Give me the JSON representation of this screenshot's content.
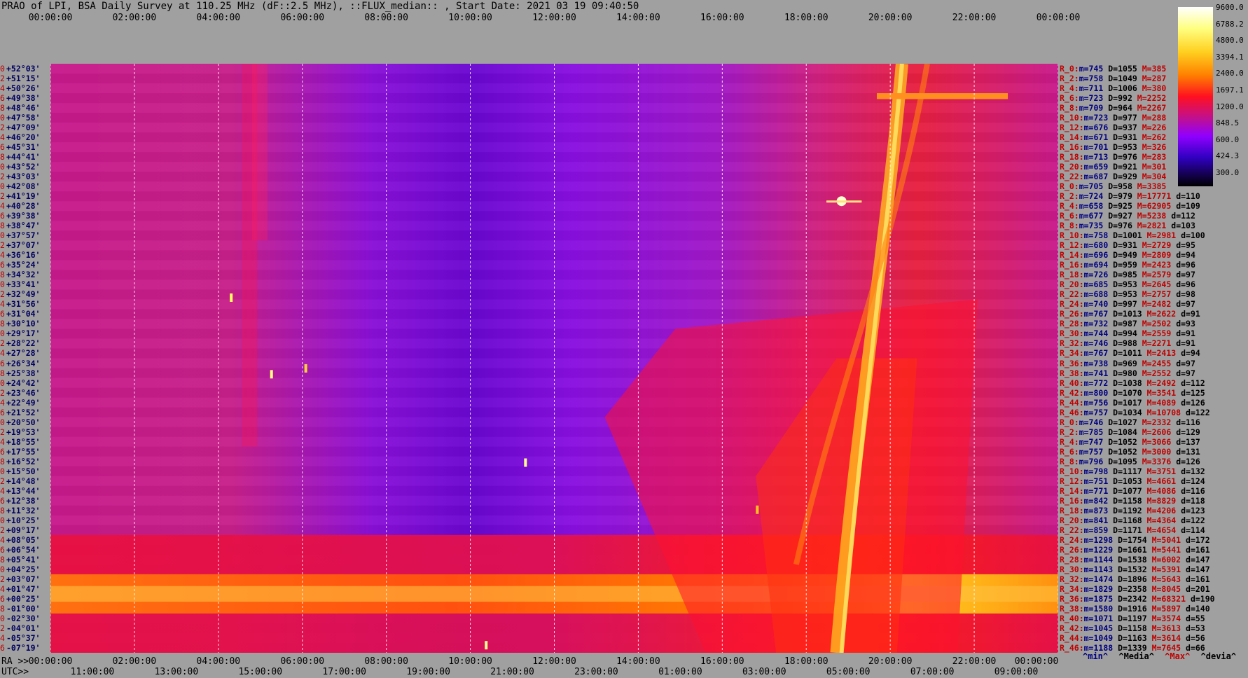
{
  "title": "PRAO of LPI, BSA Daily Survey at 110.25 MHz (dF::2.5 MHz), ::FLUX_median:: , Start Date: 2021 03 19 09:40:50",
  "chart_data": {
    "type": "heatmap",
    "title": "PRAO of LPI, BSA Daily Survey at 110.25 MHz (dF::2.5 MHz), ::FLUX_median:: , Start Date: 2021 03 19 09:40:50",
    "top_ticks": [
      "00:00:00",
      "02:00:00",
      "04:00:00",
      "06:00:00",
      "08:00:00",
      "10:00:00",
      "12:00:00",
      "14:00:00",
      "16:00:00",
      "18:00:00",
      "20:00:00",
      "22:00:00",
      "00:00:00"
    ],
    "ra_prefix": "RA >>",
    "ra_ticks": [
      "00:00:00",
      "02:00:00",
      "04:00:00",
      "06:00:00",
      "08:00:00",
      "10:00:00",
      "12:00:00",
      "14:00:00",
      "16:00:00",
      "18:00:00",
      "20:00:00",
      "22:00:00",
      "00:00:00"
    ],
    "utc_prefix": "UTC>>",
    "utc_ticks": [
      "11:00:00",
      "13:00:00",
      "15:00:00",
      "17:00:00",
      "19:00:00",
      "21:00:00",
      "23:00:00",
      "01:00:00",
      "03:00:00",
      "05:00:00",
      "07:00:00",
      "09:00:00"
    ],
    "colorbar": {
      "labels": [
        "9600.0",
        "6788.2",
        "4800.0",
        "3394.1",
        "2400.0",
        "1697.1",
        "1200.0",
        "848.5",
        "600.0",
        "424.3",
        "300.0"
      ],
      "range": [
        300,
        9600
      ],
      "scale": "log",
      "colors": [
        "#000010",
        "#2a0090",
        "#8000ff",
        "#c020c0",
        "#ff0030",
        "#ff5000",
        "#ffa000",
        "#ffe040",
        "#ffffc0"
      ]
    },
    "declination_rows": [
      {
        "i": "0",
        "dec": "+52°03'"
      },
      {
        "i": "2",
        "dec": "+51°15'"
      },
      {
        "i": "4",
        "dec": "+50°26'"
      },
      {
        "i": "6",
        "dec": "+49°38'"
      },
      {
        "i": "8",
        "dec": "+48°46'"
      },
      {
        "i": "10",
        "dec": "+47°58'"
      },
      {
        "i": "12",
        "dec": "+47°09'"
      },
      {
        "i": "14",
        "dec": "+46°20'"
      },
      {
        "i": "16",
        "dec": "+45°31'"
      },
      {
        "i": "18",
        "dec": "+44°41'"
      },
      {
        "i": "20",
        "dec": "+43°52'"
      },
      {
        "i": "22",
        "dec": "+43°03'"
      },
      {
        "i": "0",
        "dec": "+42°08'"
      },
      {
        "i": "2",
        "dec": "+41°19'"
      },
      {
        "i": "4",
        "dec": "+40°28'"
      },
      {
        "i": "6",
        "dec": "+39°38'"
      },
      {
        "i": "8",
        "dec": "+38°47'"
      },
      {
        "i": "10",
        "dec": "+37°57'"
      },
      {
        "i": "12",
        "dec": "+37°07'"
      },
      {
        "i": "14",
        "dec": "+36°16'"
      },
      {
        "i": "16",
        "dec": "+35°24'"
      },
      {
        "i": "18",
        "dec": "+34°32'"
      },
      {
        "i": "20",
        "dec": "+33°41'"
      },
      {
        "i": "22",
        "dec": "+32°49'"
      },
      {
        "i": "24",
        "dec": "+31°56'"
      },
      {
        "i": "26",
        "dec": "+31°04'"
      },
      {
        "i": "28",
        "dec": "+30°10'"
      },
      {
        "i": "30",
        "dec": "+29°17'"
      },
      {
        "i": "32",
        "dec": "+28°22'"
      },
      {
        "i": "34",
        "dec": "+27°28'"
      },
      {
        "i": "36",
        "dec": "+26°34'"
      },
      {
        "i": "38",
        "dec": "+25°38'"
      },
      {
        "i": "40",
        "dec": "+24°42'"
      },
      {
        "i": "42",
        "dec": "+23°46'"
      },
      {
        "i": "44",
        "dec": "+22°49'"
      },
      {
        "i": "46",
        "dec": "+21°52'"
      },
      {
        "i": "0",
        "dec": "+20°50'"
      },
      {
        "i": "2",
        "dec": "+19°53'"
      },
      {
        "i": "4",
        "dec": "+18°55'"
      },
      {
        "i": "6",
        "dec": "+17°55'"
      },
      {
        "i": "8",
        "dec": "+16°52'"
      },
      {
        "i": "10",
        "dec": "+15°50'"
      },
      {
        "i": "12",
        "dec": "+14°48'"
      },
      {
        "i": "14",
        "dec": "+13°44'"
      },
      {
        "i": "16",
        "dec": "+12°38'"
      },
      {
        "i": "18",
        "dec": "+11°32'"
      },
      {
        "i": "20",
        "dec": "+10°25'"
      },
      {
        "i": "22",
        "dec": "+09°17'"
      },
      {
        "i": "24",
        "dec": "+08°05'"
      },
      {
        "i": "26",
        "dec": "+06°54'"
      },
      {
        "i": "28",
        "dec": "+05°41'"
      },
      {
        "i": "30",
        "dec": "+04°25'"
      },
      {
        "i": "32",
        "dec": "+03°07'"
      },
      {
        "i": "34",
        "dec": "+01°47'"
      },
      {
        "i": "36",
        "dec": "+00°25'"
      },
      {
        "i": "38",
        "dec": "-01°00'"
      },
      {
        "i": "40",
        "dec": "-02°30'"
      },
      {
        "i": "42",
        "dec": "-04°01'"
      },
      {
        "i": "44",
        "dec": "-05°37'"
      },
      {
        "i": "46",
        "dec": "-07°19'"
      }
    ],
    "stats_rows": [
      {
        "r": "R_0:",
        "m": "745",
        "d": "1055",
        "h": "385",
        "dv": ""
      },
      {
        "r": "R_2:",
        "m": "758",
        "d": "1049",
        "h": "287",
        "dv": ""
      },
      {
        "r": "R_4:",
        "m": "711",
        "d": "1006",
        "h": "380",
        "dv": ""
      },
      {
        "r": "R_6:",
        "m": "723",
        "d": "992",
        "h": "2252",
        "dv": ""
      },
      {
        "r": "R_8:",
        "m": "709",
        "d": "964",
        "h": "2267",
        "dv": ""
      },
      {
        "r": "R_10:",
        "m": "723",
        "d": "977",
        "h": "288",
        "dv": ""
      },
      {
        "r": "R_12:",
        "m": "676",
        "d": "937",
        "h": "226",
        "dv": ""
      },
      {
        "r": "R_14:",
        "m": "671",
        "d": "931",
        "h": "262",
        "dv": ""
      },
      {
        "r": "R_16:",
        "m": "701",
        "d": "953",
        "h": "326",
        "dv": ""
      },
      {
        "r": "R_18:",
        "m": "713",
        "d": "976",
        "h": "283",
        "dv": ""
      },
      {
        "r": "R_20:",
        "m": "659",
        "d": "921",
        "h": "301",
        "dv": ""
      },
      {
        "r": "R_22:",
        "m": "687",
        "d": "929",
        "h": "304",
        "dv": ""
      },
      {
        "r": "R_0:",
        "m": "705",
        "d": "958",
        "h": "3385",
        "dv": ""
      },
      {
        "r": "R_2:",
        "m": "724",
        "d": "979",
        "h": "17771",
        "dv": "110"
      },
      {
        "r": "R_4:",
        "m": "658",
        "d": "925",
        "h": "62905",
        "dv": "109"
      },
      {
        "r": "R_6:",
        "m": "677",
        "d": "927",
        "h": "5238",
        "dv": "112"
      },
      {
        "r": "R_8:",
        "m": "735",
        "d": "976",
        "h": "2821",
        "dv": "103"
      },
      {
        "r": "R_10:",
        "m": "758",
        "d": "1001",
        "h": "2981",
        "dv": "100"
      },
      {
        "r": "R_12:",
        "m": "680",
        "d": "931",
        "h": "2729",
        "dv": "95"
      },
      {
        "r": "R_14:",
        "m": "696",
        "d": "949",
        "h": "2809",
        "dv": "94"
      },
      {
        "r": "R_16:",
        "m": "694",
        "d": "959",
        "h": "2423",
        "dv": "96"
      },
      {
        "r": "R_18:",
        "m": "726",
        "d": "985",
        "h": "2579",
        "dv": "97"
      },
      {
        "r": "R_20:",
        "m": "685",
        "d": "953",
        "h": "2645",
        "dv": "96"
      },
      {
        "r": "R_22:",
        "m": "688",
        "d": "953",
        "h": "2757",
        "dv": "98"
      },
      {
        "r": "R_24:",
        "m": "740",
        "d": "997",
        "h": "2482",
        "dv": "97"
      },
      {
        "r": "R_26:",
        "m": "767",
        "d": "1013",
        "h": "2622",
        "dv": "91"
      },
      {
        "r": "R_28:",
        "m": "732",
        "d": "987",
        "h": "2502",
        "dv": "93"
      },
      {
        "r": "R_30:",
        "m": "744",
        "d": "994",
        "h": "2559",
        "dv": "91"
      },
      {
        "r": "R_32:",
        "m": "746",
        "d": "988",
        "h": "2271",
        "dv": "91"
      },
      {
        "r": "R_34:",
        "m": "767",
        "d": "1011",
        "h": "2413",
        "dv": "94"
      },
      {
        "r": "R_36:",
        "m": "738",
        "d": "969",
        "h": "2455",
        "dv": "97"
      },
      {
        "r": "R_38:",
        "m": "741",
        "d": "980",
        "h": "2552",
        "dv": "97"
      },
      {
        "r": "R_40:",
        "m": "772",
        "d": "1038",
        "h": "2492",
        "dv": "112"
      },
      {
        "r": "R_42:",
        "m": "800",
        "d": "1070",
        "h": "3541",
        "dv": "125"
      },
      {
        "r": "R_44:",
        "m": "756",
        "d": "1017",
        "h": "4089",
        "dv": "126"
      },
      {
        "r": "R_46:",
        "m": "757",
        "d": "1034",
        "h": "10708",
        "dv": "122"
      },
      {
        "r": "R_0:",
        "m": "746",
        "d": "1027",
        "h": "2332",
        "dv": "116"
      },
      {
        "r": "R_2:",
        "m": "785",
        "d": "1084",
        "h": "2606",
        "dv": "129"
      },
      {
        "r": "R_4:",
        "m": "747",
        "d": "1052",
        "h": "3066",
        "dv": "137"
      },
      {
        "r": "R_6:",
        "m": "757",
        "d": "1052",
        "h": "3000",
        "dv": "131"
      },
      {
        "r": "R_8:",
        "m": "796",
        "d": "1095",
        "h": "3376",
        "dv": "126"
      },
      {
        "r": "R_10:",
        "m": "798",
        "d": "1117",
        "h": "3751",
        "dv": "132"
      },
      {
        "r": "R_12:",
        "m": "751",
        "d": "1053",
        "h": "4661",
        "dv": "124"
      },
      {
        "r": "R_14:",
        "m": "771",
        "d": "1077",
        "h": "4086",
        "dv": "116"
      },
      {
        "r": "R_16:",
        "m": "842",
        "d": "1158",
        "h": "8829",
        "dv": "118"
      },
      {
        "r": "R_18:",
        "m": "873",
        "d": "1192",
        "h": "4206",
        "dv": "123"
      },
      {
        "r": "R_20:",
        "m": "841",
        "d": "1168",
        "h": "4364",
        "dv": "122"
      },
      {
        "r": "R_22:",
        "m": "859",
        "d": "1171",
        "h": "4654",
        "dv": "114"
      },
      {
        "r": "R_24:",
        "m": "1298",
        "d": "1754",
        "h": "5041",
        "dv": "172"
      },
      {
        "r": "R_26:",
        "m": "1229",
        "d": "1661",
        "h": "5441",
        "dv": "161"
      },
      {
        "r": "R_28:",
        "m": "1144",
        "d": "1538",
        "h": "6002",
        "dv": "147"
      },
      {
        "r": "R_30:",
        "m": "1143",
        "d": "1532",
        "h": "5391",
        "dv": "147"
      },
      {
        "r": "R_32:",
        "m": "1474",
        "d": "1896",
        "h": "5643",
        "dv": "161"
      },
      {
        "r": "R_34:",
        "m": "1829",
        "d": "2358",
        "h": "8045",
        "dv": "201"
      },
      {
        "r": "R_36:",
        "m": "1875",
        "d": "2342",
        "h": "68321",
        "dv": "190"
      },
      {
        "r": "R_38:",
        "m": "1580",
        "d": "1916",
        "h": "5897",
        "dv": "140"
      },
      {
        "r": "R_40:",
        "m": "1071",
        "d": "1197",
        "h": "3574",
        "dv": "55"
      },
      {
        "r": "R_42:",
        "m": "1045",
        "d": "1158",
        "h": "3613",
        "dv": "53"
      },
      {
        "r": "R_44:",
        "m": "1049",
        "d": "1163",
        "h": "3614",
        "dv": "56"
      },
      {
        "r": "R_46:",
        "m": "1188",
        "d": "1339",
        "h": "7645",
        "dv": "66"
      }
    ],
    "stats_legend": [
      "^min^",
      "^Media^",
      "^Max^",
      "^devia^"
    ],
    "stat_prefixes": {
      "min": "m=",
      "median": "D=",
      "max": "M=",
      "dev": "d="
    }
  },
  "colors": {
    "background": "#a0a0a0",
    "grid": "#ffffff",
    "label_red": "#c00000",
    "label_navy": "#000060"
  }
}
